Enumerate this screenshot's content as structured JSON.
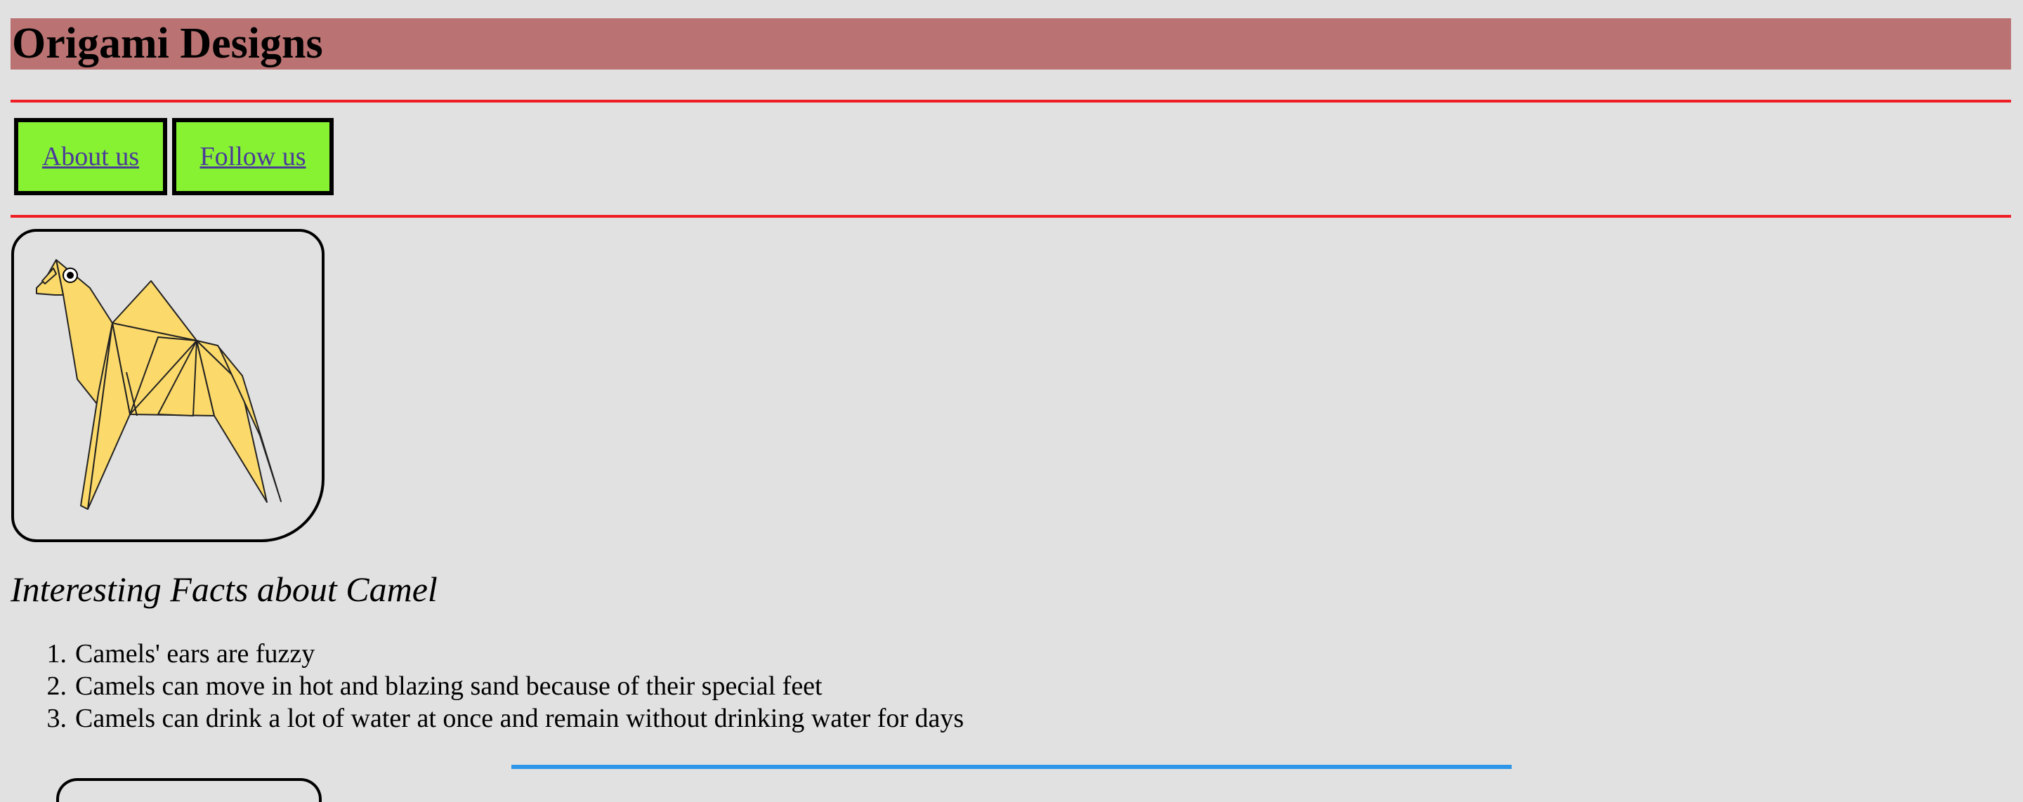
{
  "header": {
    "title": "Origami Designs"
  },
  "nav": {
    "about_label": "About us",
    "follow_label": "Follow us"
  },
  "image": {
    "alt": "Origami camel"
  },
  "facts": {
    "heading": "Interesting Facts about Camel",
    "items": [
      {
        "num": "1.",
        "text": "Camels' ears are fuzzy"
      },
      {
        "num": "2.",
        "text": "Camels can move in hot and blazing sand because of their special feet"
      },
      {
        "num": "3.",
        "text": "Camels can drink a lot of water at once and remain without drinking water for days"
      }
    ]
  },
  "colors": {
    "background": "#e1e1e1",
    "title_bar": "#ba7272",
    "divider": "#ee1e24",
    "nav_button": "#87f232",
    "camel": "#fbd96a",
    "blue_rule": "#2e96e8"
  }
}
